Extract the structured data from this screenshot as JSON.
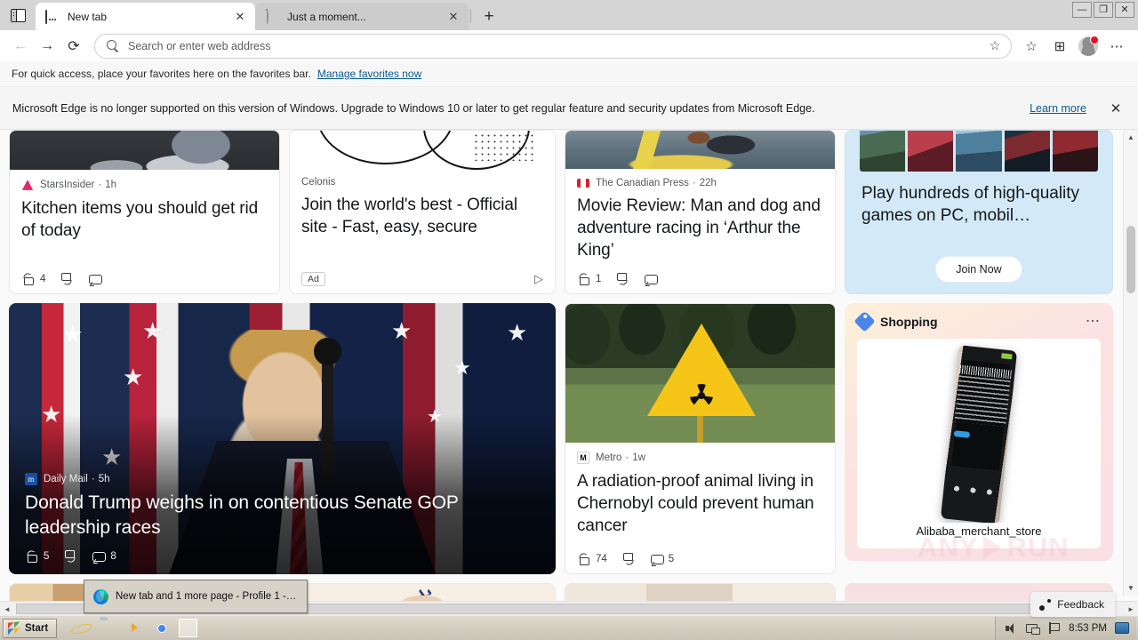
{
  "window": {
    "controls": {
      "minimize": "—",
      "restore": "❐",
      "close": "✕"
    }
  },
  "tabs": {
    "tab_search_icon": "tab-search-icon",
    "items": [
      {
        "title": "New tab",
        "favicon": "new-tab-icon",
        "active": true,
        "close": "✕"
      },
      {
        "title": "Just a moment...",
        "favicon": "loading-spinner-icon",
        "active": false,
        "close": "✕"
      }
    ],
    "new_tab_button": "+"
  },
  "toolbar": {
    "back": "←",
    "forward": "→",
    "refresh": "⟳",
    "address_placeholder": "Search or enter web address",
    "add_favorite_icon": "star-plus-icon",
    "favorites_icon": "favorites-list-icon",
    "collections_icon": "collections-icon",
    "profile_icon": "profile-avatar-icon",
    "settings_icon": "more-options-icon"
  },
  "favorites_bar": {
    "hint": "For quick access, place your favorites here on the favorites bar.",
    "manage_link": "Manage favorites now"
  },
  "banner": {
    "message": "Microsoft Edge is no longer supported on this version of Windows. Upgrade to Windows 10 or later to get regular feature and security updates from Microsoft Edge.",
    "learn_more": "Learn more",
    "close": "✕"
  },
  "feed": {
    "cards": [
      {
        "source": "StarsInsider",
        "time": "1h",
        "headline": "Kitchen items you should get rid of today",
        "likes": "4",
        "dislikes": "",
        "comments": ""
      },
      {
        "source": "Celonis",
        "time": "",
        "headline": "Join the world's best - Official site - Fast, easy, secure",
        "ad_label": "Ad",
        "ad_info_icon": "ad-info-icon"
      },
      {
        "source": "The Canadian Press",
        "time": "22h",
        "headline": "Movie Review: Man and dog and adventure racing in ‘Arthur the King’",
        "likes": "1",
        "dislikes": "",
        "comments": ""
      },
      {
        "source": "Daily Mail",
        "time": "5h",
        "headline": "Donald Trump weighs in on contentious Senate GOP leadership races",
        "likes": "5",
        "dislikes": "",
        "comments": "8"
      },
      {
        "source": "Metro",
        "time": "1w",
        "headline": "A radiation-proof animal living in Chernobyl could prevent human cancer",
        "likes": "74",
        "dislikes": "",
        "comments": "5"
      }
    ],
    "gamepass": {
      "headline": "Play hundreds of high-quality games on PC, mobil…",
      "button": "Join Now"
    },
    "shopping": {
      "title": "Shopping",
      "tag_icon": "price-tag-icon",
      "more_icon": "more-options-icon",
      "product_label": "Alibaba_merchant_store"
    }
  },
  "watermark": {
    "text_left": "ANY",
    "text_right": "RUN"
  },
  "feedback": {
    "label": "Feedback",
    "icon": "feedback-icon"
  },
  "scrollbars": {
    "vertical_up": "▲",
    "vertical_down": "▼",
    "horizontal_left": "◄",
    "horizontal_right": "►"
  },
  "tooltip": {
    "text": "New tab and 1 more page - Profile 1 - Mi…",
    "icon": "edge-icon"
  },
  "taskbar": {
    "start_label": "Start",
    "quick_launch": [
      {
        "name": "internet-explorer-icon"
      },
      {
        "name": "file-explorer-icon"
      },
      {
        "name": "windows-media-player-icon"
      },
      {
        "name": "google-chrome-icon"
      },
      {
        "name": "microsoft-edge-icon"
      }
    ],
    "tray": {
      "volume_icon": "volume-icon",
      "network_icon": "network-icon",
      "flag_icon": "security-flag-icon",
      "clock": "8:53 PM",
      "display_icon": "display-icon"
    }
  }
}
